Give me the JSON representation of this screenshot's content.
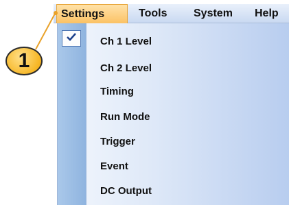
{
  "menubar": {
    "items": [
      {
        "label": "Settings",
        "active": true
      },
      {
        "label": "Tools"
      },
      {
        "label": "System"
      },
      {
        "label": "Help"
      }
    ]
  },
  "settings_menu": {
    "items": [
      {
        "label": "Ch 1 Level",
        "checked": true
      },
      {
        "label": "Ch 2 Level"
      },
      {
        "label": "Timing"
      },
      {
        "label": "Run Mode"
      },
      {
        "label": "Trigger"
      },
      {
        "label": "Event"
      },
      {
        "label": "DC Output"
      }
    ]
  },
  "callout": {
    "number": "1"
  },
  "icons": {
    "check": "checkmark-icon"
  },
  "colors": {
    "active_menu": "#fbc265",
    "menu_gutter": "#8fb4df",
    "callout_fill": "#f7b727"
  }
}
